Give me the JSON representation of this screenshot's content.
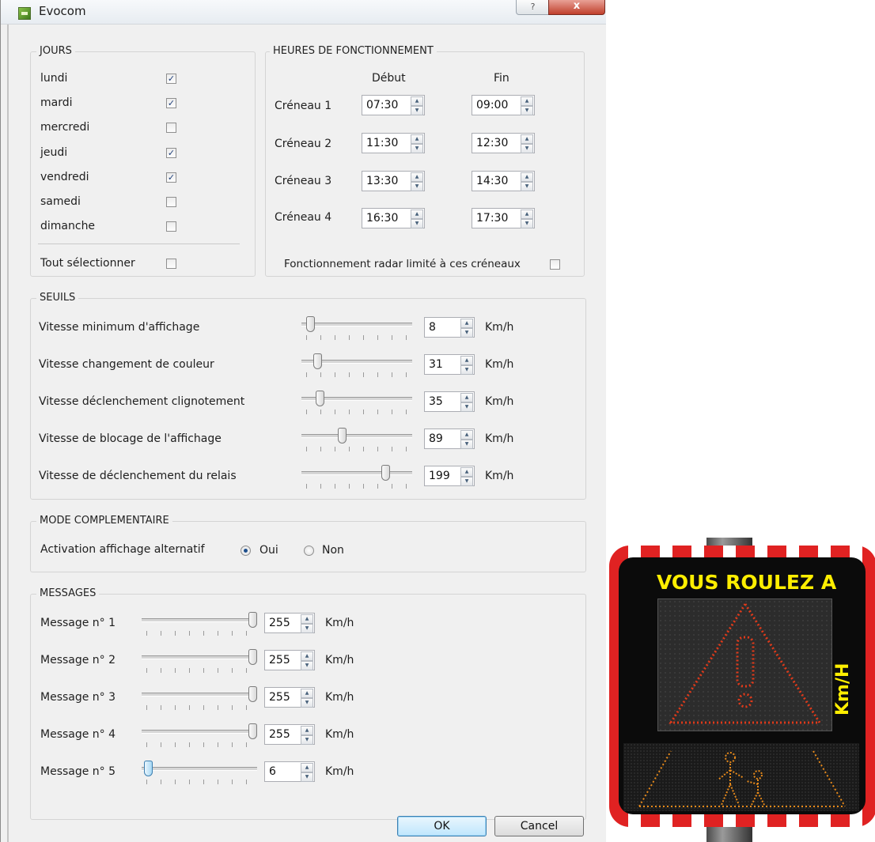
{
  "window": {
    "title": "Evocom",
    "help_label": "?",
    "close_label": "x"
  },
  "jours": {
    "title": "JOURS",
    "days": [
      {
        "label": "lundi",
        "checked": true
      },
      {
        "label": "mardi",
        "checked": true
      },
      {
        "label": "mercredi",
        "checked": false
      },
      {
        "label": "jeudi",
        "checked": true
      },
      {
        "label": "vendredi",
        "checked": true
      },
      {
        "label": "samedi",
        "checked": false
      },
      {
        "label": "dimanche",
        "checked": false
      }
    ],
    "select_all_label": "Tout sélectionner",
    "select_all_checked": false
  },
  "heures": {
    "title": "HEURES DE FONCTIONNEMENT",
    "col_start": "Début",
    "col_end": "Fin",
    "slots": [
      {
        "label": "Créneau 1",
        "start": "07:30",
        "end": "09:00"
      },
      {
        "label": "Créneau 2",
        "start": "11:30",
        "end": "12:30"
      },
      {
        "label": "Créneau 3",
        "start": "13:30",
        "end": "14:30"
      },
      {
        "label": "Créneau 4",
        "start": "16:30",
        "end": "17:30"
      }
    ],
    "limit_label": "Fonctionnement radar limité à ces créneaux",
    "limit_checked": false
  },
  "seuils": {
    "title": "SEUILS",
    "unit": "Km/h",
    "rows": [
      {
        "label": "Vitesse minimum d'affichage",
        "value": "8",
        "fraction": 0.05
      },
      {
        "label": "Vitesse changement de couleur",
        "value": "31",
        "fraction": 0.12
      },
      {
        "label": "Vitesse déclenchement clignotement",
        "value": "35",
        "fraction": 0.14
      },
      {
        "label": "Vitesse de blocage de l'affichage",
        "value": "89",
        "fraction": 0.36
      },
      {
        "label": "Vitesse de déclenchement du relais",
        "value": "199",
        "fraction": 0.78
      }
    ]
  },
  "mode": {
    "title": "MODE COMPLEMENTAIRE",
    "label": "Activation affichage alternatif",
    "oui": "Oui",
    "non": "Non",
    "selected": "Oui"
  },
  "messages": {
    "title": "MESSAGES",
    "unit": "Km/h",
    "rows": [
      {
        "label": "Message n° 1",
        "value": "255",
        "fraction": 1.0
      },
      {
        "label": "Message n° 2",
        "value": "255",
        "fraction": 1.0
      },
      {
        "label": "Message n° 3",
        "value": "255",
        "fraction": 1.0
      },
      {
        "label": "Message n° 4",
        "value": "255",
        "fraction": 1.0
      },
      {
        "label": "Message n° 5",
        "value": "6",
        "fraction": 0.02
      }
    ]
  },
  "buttons": {
    "ok": "OK",
    "cancel": "Cancel"
  },
  "sign": {
    "headline": "VOUS ROULEZ A",
    "unit": "Km/H"
  },
  "colors": {
    "sign_text": "#ffee00",
    "led_red": "#e03a1a",
    "led_orange": "#e88a1a"
  }
}
